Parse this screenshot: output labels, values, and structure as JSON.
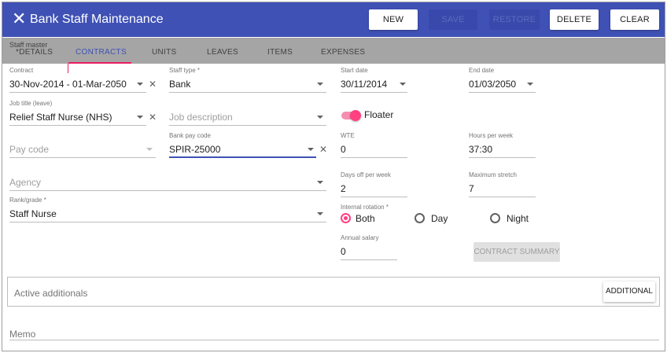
{
  "header": {
    "title": "Bank Staff Maintenance",
    "buttons": {
      "new": "NEW",
      "save": "SAVE",
      "restore": "RESTORE",
      "delete": "DELETE",
      "clear": "CLEAR"
    }
  },
  "tabs": {
    "group_label": "Staff master",
    "items": [
      "*DETAILS",
      "CONTRACTS",
      "UNITS",
      "LEAVES",
      "ITEMS",
      "EXPENSES"
    ],
    "active": "CONTRACTS"
  },
  "form": {
    "contract": {
      "label": "Contract",
      "value": "30-Nov-2014 - 01-Mar-2050"
    },
    "staff_type": {
      "label": "Staff type *",
      "value": "Bank"
    },
    "start_date": {
      "label": "Start date",
      "value": "30/11/2014"
    },
    "end_date": {
      "label": "End date",
      "value": "01/03/2050"
    },
    "job_title": {
      "label": "Job title (leave)",
      "value": "Relief Staff Nurse (NHS)"
    },
    "job_description": {
      "placeholder": "Job description"
    },
    "floater": {
      "label": "Floater",
      "on": true
    },
    "pay_code": {
      "placeholder": "Pay code"
    },
    "bank_pay_code": {
      "label": "Bank pay code",
      "value": "SPIR-25000"
    },
    "wte": {
      "label": "WTE",
      "value": "0"
    },
    "hours_per_week": {
      "label": "Hours per week",
      "value": "37:30"
    },
    "agency": {
      "placeholder": "Agency"
    },
    "days_off_per_week": {
      "label": "Days off per week",
      "value": "2"
    },
    "maximum_stretch": {
      "label": "Maximum stretch",
      "value": "7"
    },
    "rank_grade": {
      "label": "Rank/grade *",
      "value": "Staff Nurse"
    },
    "internal_rotation": {
      "label": "Internal rotation *",
      "options": [
        "Both",
        "Day",
        "Night"
      ],
      "selected": "Both"
    },
    "annual_salary": {
      "label": "Annual salary",
      "value": "0"
    },
    "contract_summary_button": "CONTRACT SUMMARY"
  },
  "additionals": {
    "title": "Active additionals",
    "button": "ADDITIONAL"
  },
  "memo": {
    "placeholder": "Memo"
  },
  "colors": {
    "primary": "#3f51b5",
    "accent": "#ff4081",
    "tab_bar": "#a5a5a5"
  }
}
